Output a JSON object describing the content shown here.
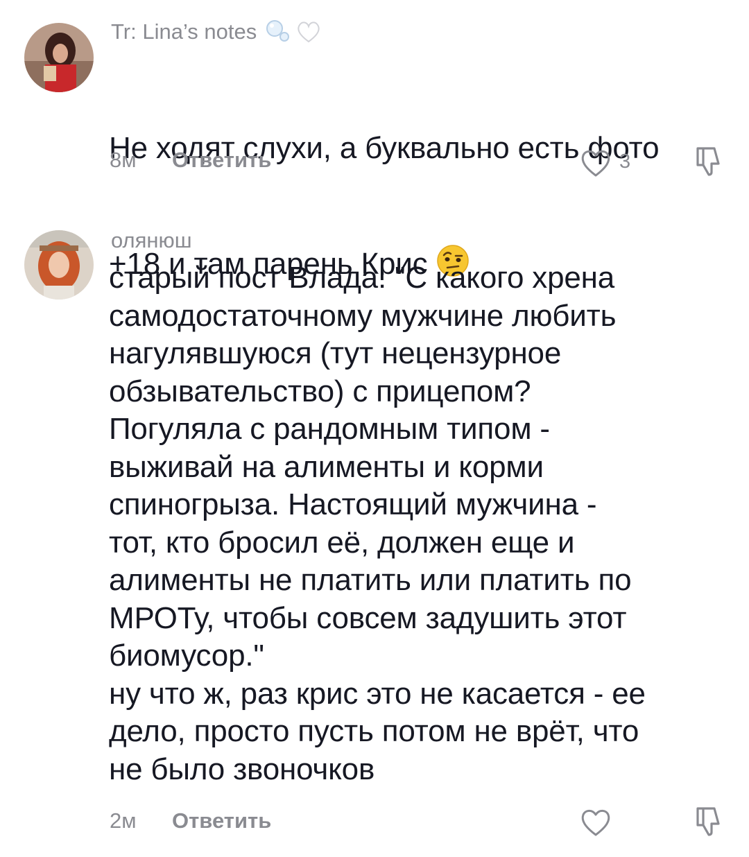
{
  "comments": [
    {
      "author": "Tr: Lina’s notes",
      "text_line1": "Не ходят слухи, а буквально есть фото",
      "text_line2": "+18 и там парень Крис",
      "time": "8м",
      "reply_label": "Ответить",
      "like_count": "3",
      "author_emoji_icons": [
        "bubbles-icon",
        "white-heart-icon"
      ],
      "text_emoji_icon": "face-raised-eyebrow-icon"
    },
    {
      "author": "олянюш",
      "text": "старый пост Влада: \"С какого хрена\nсамодостаточному мужчине любить\nнагулявшуюся (тут нецензурное\nобзывательство) с прицепом?\nПогуляла с рандомным типом -\nвыживай на алименты и корми\nспиногрыза. Настоящий мужчина -\nтот, кто бросил её, должен еще и\nалименты не платить или платить по\nМРОТу, чтобы совсем задушить этот\nбиомусор.\"\nну что ж, раз крис это не касается - ее\nдело, просто пусть потом не врёт, что\nне было звоночков",
      "time": "2м",
      "reply_label": "Ответить",
      "like_count": ""
    }
  ],
  "colors": {
    "text": "#161823",
    "secondary": "#8a8b91",
    "background": "#ffffff"
  }
}
